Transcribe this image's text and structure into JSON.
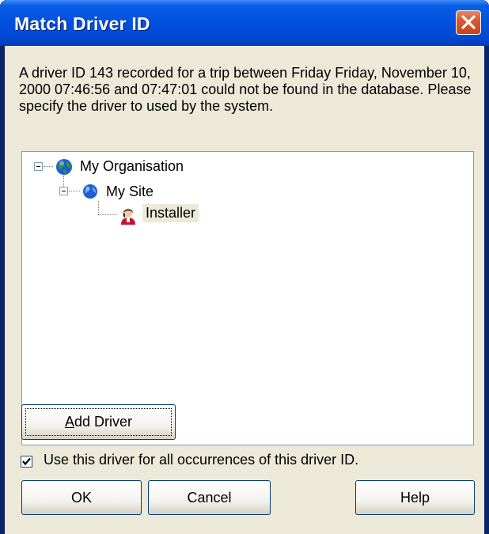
{
  "window": {
    "title": "Match Driver ID"
  },
  "message": "A driver ID 143 recorded for a trip between Friday Friday, November 10, 2000 07:46:56 and 07:47:01 could not be found in the database. Please specify the driver to used by the system.",
  "tree": {
    "organisation": {
      "label": "My Organisation",
      "icon": "globe-icon",
      "expanded": true
    },
    "site": {
      "label": "My Site",
      "icon": "globe-icon",
      "expanded": true
    },
    "driver": {
      "label": "Installer",
      "icon": "driver-person-icon",
      "selected": true
    }
  },
  "buttons": {
    "add_driver_accel": "A",
    "add_driver_rest": "dd Driver",
    "ok": "OK",
    "cancel": "Cancel",
    "help": "Help"
  },
  "checkbox": {
    "label": "Use this driver for all occurrences of this driver ID.",
    "checked": true
  }
}
